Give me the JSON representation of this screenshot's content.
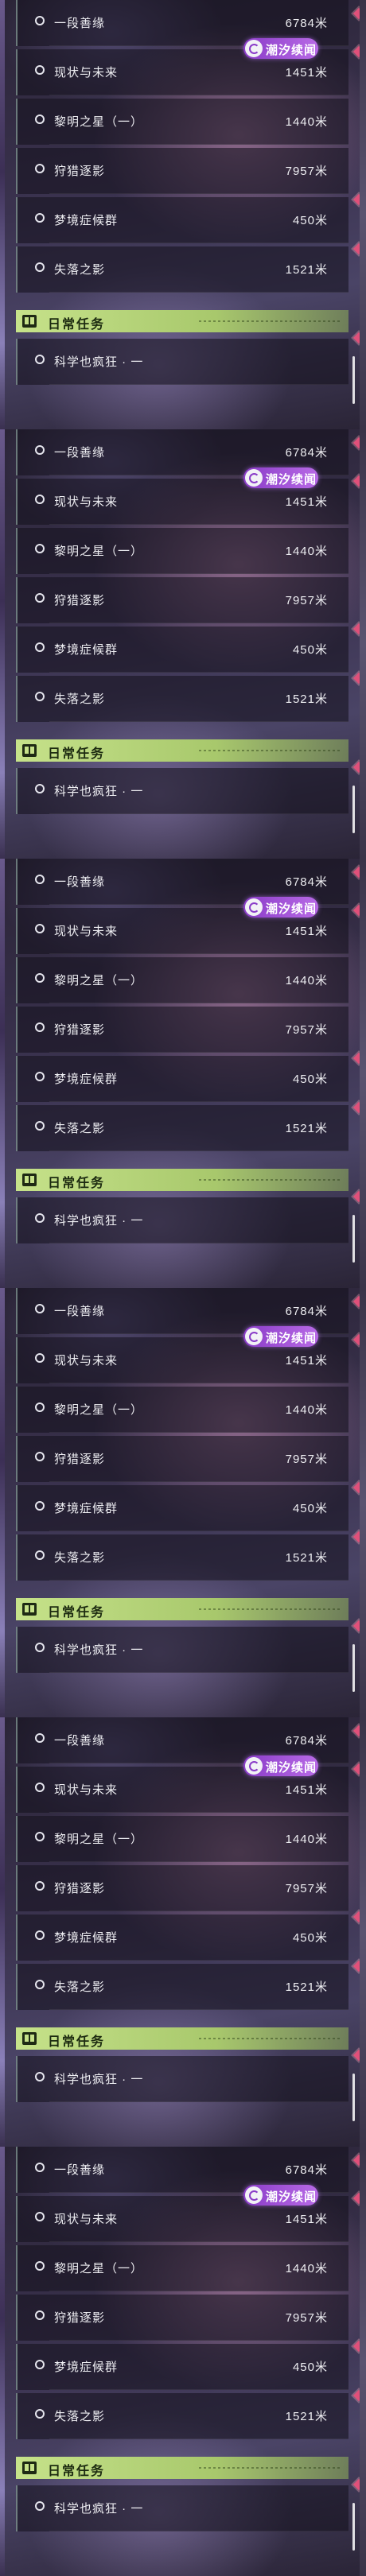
{
  "quests": [
    {
      "name": "一段善缘",
      "distance": "6784米"
    },
    {
      "name": "现状与未来",
      "distance": "1451米"
    },
    {
      "name": "黎明之星（一）",
      "distance": "1440米"
    },
    {
      "name": "狩猎逐影",
      "distance": "7957米"
    },
    {
      "name": "梦境症候群",
      "distance": "450米"
    },
    {
      "name": "失落之影",
      "distance": "1521米"
    }
  ],
  "event_badge": {
    "label": "潮汐续闻",
    "icon": "tide-event-icon"
  },
  "daily": {
    "title": "日常任务",
    "icon": "book-icon",
    "quest": {
      "name": "科学也疯狂 · 一"
    }
  },
  "colors": {
    "accent_green": "#c6e28a",
    "badge_purple": "#8a3cc8",
    "marker_red": "#e0507a"
  }
}
